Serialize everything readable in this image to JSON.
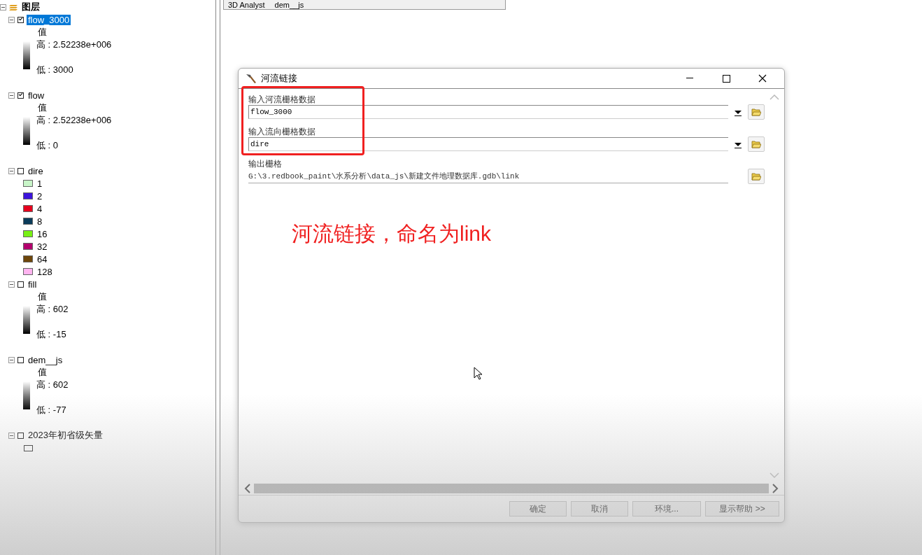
{
  "toolbar": {
    "items": [
      "3D Analyst",
      "dem__js"
    ]
  },
  "toc": {
    "title": "图层",
    "layers": [
      {
        "name": "flow_3000",
        "checked": true,
        "selected": true,
        "kind": "stretch",
        "header": "值",
        "high": "高 : 2.52238e+006",
        "low": "低 : 3000"
      },
      {
        "name": "flow",
        "checked": true,
        "selected": false,
        "kind": "stretch",
        "header": "值",
        "high": "高 : 2.52238e+006",
        "low": "低 : 0"
      },
      {
        "name": "dire",
        "checked": false,
        "selected": false,
        "kind": "classes",
        "classes": [
          {
            "label": "1",
            "color": "#c8f5c8"
          },
          {
            "label": "2",
            "color": "#3c14dc"
          },
          {
            "label": "4",
            "color": "#e6001e"
          },
          {
            "label": "8",
            "color": "#0a3c5a"
          },
          {
            "label": "16",
            "color": "#78f014"
          },
          {
            "label": "32",
            "color": "#b4006e"
          },
          {
            "label": "64",
            "color": "#6e460a"
          },
          {
            "label": "128",
            "color": "#ffb4f0"
          }
        ]
      },
      {
        "name": "fill",
        "checked": false,
        "selected": false,
        "kind": "stretch",
        "header": "值",
        "high": "高 : 602",
        "low": "低 : -15"
      },
      {
        "name": "dem__js",
        "checked": false,
        "selected": false,
        "kind": "stretch",
        "header": "值",
        "high": "高 : 602",
        "low": "低 : -77"
      },
      {
        "name": "2023年初省级矢量",
        "checked": false,
        "selected": false,
        "kind": "symbol"
      }
    ]
  },
  "dialog": {
    "title": "河流链接",
    "fields": [
      {
        "label": "输入河流栅格数据",
        "value": "flow_3000",
        "kind": "dropdown"
      },
      {
        "label": "输入流向栅格数据",
        "value": "dire",
        "kind": "dropdown"
      },
      {
        "label": "输出栅格",
        "value": "G:\\3.redbook_paint\\水系分析\\data_js\\新建文件地理数据库.gdb\\link",
        "kind": "text"
      }
    ],
    "buttons": [
      "确定",
      "取消",
      "环境...",
      "显示帮助 >>"
    ]
  },
  "annotation": {
    "text": "河流链接，命名为link"
  }
}
